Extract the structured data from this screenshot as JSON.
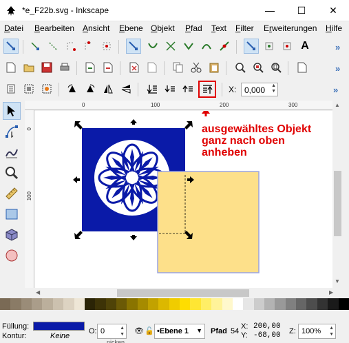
{
  "window": {
    "title": "*e_F22b.svg - Inkscape",
    "minimize": "—",
    "maximize": "☐",
    "close": "✕"
  },
  "menu": [
    {
      "label": "Datei",
      "underline": "D"
    },
    {
      "label": "Bearbeiten",
      "underline": "B"
    },
    {
      "label": "Ansicht",
      "underline": "A"
    },
    {
      "label": "Ebene",
      "underline": "E"
    },
    {
      "label": "Objekt",
      "underline": "O"
    },
    {
      "label": "Pfad",
      "underline": "P"
    },
    {
      "label": "Text",
      "underline": "T"
    },
    {
      "label": "Filter",
      "underline": "F"
    },
    {
      "label": "Erweiterungen",
      "underline": "r"
    },
    {
      "label": "Hilfe",
      "underline": "H"
    }
  ],
  "select_toolbar": {
    "x_label": "X:",
    "x_value": "0,000"
  },
  "rulers": {
    "h_ticks": [
      "0",
      "100",
      "200",
      "300"
    ],
    "v_ticks": [
      "0",
      "100"
    ]
  },
  "annotation": {
    "lines": [
      "ausgewähltes Objekt",
      "ganz nach oben",
      "anheben"
    ],
    "color": "#e00000"
  },
  "canvas": {
    "blue_square_color": "#0a1aa8",
    "yellow_rect_color": "#fde08a",
    "yellow_rect_border": "#9aa3e0"
  },
  "palette": [
    "#7a6a55",
    "#8a7b66",
    "#9a8c78",
    "#aa9d8a",
    "#bbaf9c",
    "#ccc1af",
    "#ddd3c2",
    "#eee6d6",
    "#2b2406",
    "#3d3307",
    "#4f4308",
    "#6b5a06",
    "#8a7400",
    "#a68b00",
    "#c2a200",
    "#dcb800",
    "#f0cc00",
    "#ffdd00",
    "#ffe633",
    "#ffee66",
    "#fff399",
    "#fff8cc",
    "#ffffff",
    "#e6e6e6",
    "#cccccc",
    "#b3b3b3",
    "#999999",
    "#808080",
    "#666666",
    "#4d4d4d",
    "#333333",
    "#1a1a1a",
    "#000000"
  ],
  "status": {
    "fill_label": "Füllung:",
    "stroke_label": "Kontur:",
    "stroke_value": "Keine",
    "fill_color": "#0a1aa8",
    "opacity_label": "O:",
    "opacity_value": "0",
    "layer_value": "•Ebene 1",
    "object_type": "Pfad",
    "object_count": "54",
    "x_label": "X:",
    "x_value": "200,00",
    "y_label": "Y:",
    "y_value": "-68,00",
    "zoom_label": "Z:",
    "zoom_value": "100%",
    "hidden_text": "nicken"
  }
}
